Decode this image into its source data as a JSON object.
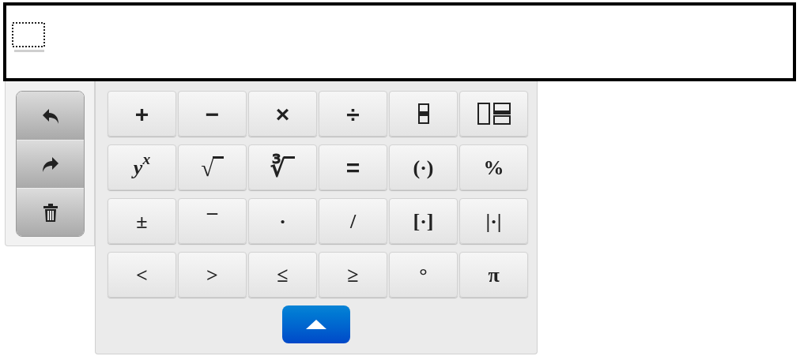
{
  "editor": {
    "empty": true
  },
  "history_buttons": [
    {
      "kind": "undo"
    },
    {
      "kind": "redo"
    },
    {
      "kind": "clear"
    }
  ],
  "keys": [
    {
      "kind": "text",
      "label": "+"
    },
    {
      "kind": "text",
      "label": "−"
    },
    {
      "kind": "text",
      "label": "×"
    },
    {
      "kind": "text",
      "label": "÷"
    },
    {
      "kind": "fraction"
    },
    {
      "kind": "mixed-fraction"
    },
    {
      "kind": "power",
      "label": "y$^{x}$"
    },
    {
      "kind": "root",
      "label": "√"
    },
    {
      "kind": "root",
      "label": "∛"
    },
    {
      "kind": "text",
      "label": "="
    },
    {
      "kind": "serif",
      "label": "(·)"
    },
    {
      "kind": "serif",
      "label": "%"
    },
    {
      "kind": "serif",
      "label": "±"
    },
    {
      "kind": "serif",
      "label": "¯"
    },
    {
      "kind": "serif",
      "label": "·"
    },
    {
      "kind": "serif",
      "label": "/"
    },
    {
      "kind": "serif",
      "label": "[·]"
    },
    {
      "kind": "serif",
      "label": "|·|"
    },
    {
      "kind": "serif",
      "label": "<"
    },
    {
      "kind": "serif",
      "label": ">"
    },
    {
      "kind": "serif",
      "label": "≤"
    },
    {
      "kind": "serif",
      "label": "≥"
    },
    {
      "kind": "serif",
      "label": "°"
    },
    {
      "kind": "serif",
      "label": "π"
    }
  ],
  "keypad": {
    "expanded": true
  }
}
